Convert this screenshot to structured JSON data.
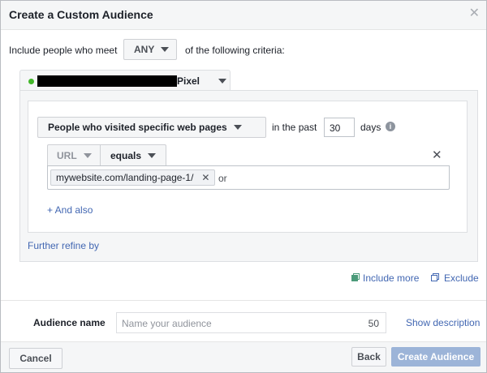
{
  "dialog": {
    "title": "Create a Custom Audience",
    "close_icon": "close-icon"
  },
  "criteria": {
    "prefix": "Include people who meet",
    "match_value": "ANY",
    "suffix": "of the following criteria:"
  },
  "pixel": {
    "status_color": "#42b72a",
    "label": "Pixel"
  },
  "rule": {
    "event_value": "People who visited specific web pages",
    "in_the_past_label": "in the past",
    "days_value": "30",
    "days_label": "days",
    "info_icon": "info-icon",
    "field_value": "URL",
    "operator_value": "equals",
    "remove_icon": "close-icon",
    "tags": [
      "mywebsite.com/landing-page-1/"
    ],
    "or_label": "or",
    "and_also_label": "+ And also"
  },
  "further_refine_label": "Further refine by",
  "include_more_label": "Include more",
  "exclude_label": "Exclude",
  "audience_name": {
    "label": "Audience name",
    "placeholder": "Name your audience",
    "char_count": "50",
    "show_description_label": "Show description"
  },
  "footer": {
    "cancel_label": "Cancel",
    "back_label": "Back",
    "create_label": "Create Audience"
  },
  "colors": {
    "link": "#4267b2",
    "primary_disabled": "#9cb4d8"
  }
}
